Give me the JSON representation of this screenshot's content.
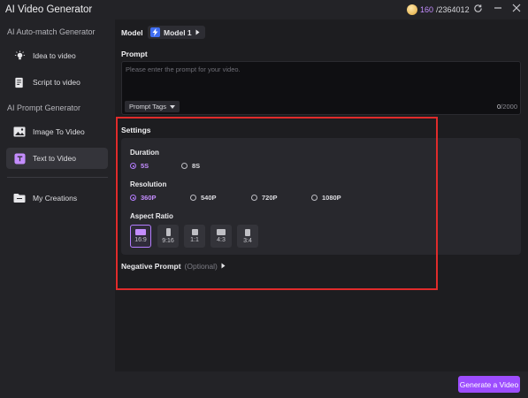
{
  "app": {
    "title": "AI Video Generator"
  },
  "credits": {
    "used": "160",
    "total": "/2364012"
  },
  "sidebar": {
    "groups": [
      "AI Auto-match Generator",
      "AI Prompt Generator"
    ],
    "items": [
      {
        "label": "Idea to video",
        "icon": "lightbulb-icon"
      },
      {
        "label": "Script to video",
        "icon": "script-icon"
      },
      {
        "label": "Image To Video",
        "icon": "image-icon"
      },
      {
        "label": "Text to Video",
        "icon": "text-icon",
        "active": true
      },
      {
        "label": "My Creations",
        "icon": "folder-icon"
      }
    ]
  },
  "model": {
    "label": "Model",
    "value": "Model 1"
  },
  "prompt": {
    "label": "Prompt",
    "placeholder": "Please enter the prompt for your video.",
    "tags_label": "Prompt Tags",
    "count_current": "0",
    "count_max": "/2000"
  },
  "settings": {
    "label": "Settings",
    "duration": {
      "label": "Duration",
      "options": [
        "5S",
        "8S"
      ],
      "selected": "5S"
    },
    "resolution": {
      "label": "Resolution",
      "options": [
        "360P",
        "540P",
        "720P",
        "1080P"
      ],
      "selected": "360P"
    },
    "aspect_ratio": {
      "label": "Aspect Ratio",
      "options": [
        "16:9",
        "9:16",
        "1:1",
        "4:3",
        "3:4"
      ],
      "selected": "16:9"
    }
  },
  "negative_prompt": {
    "label": "Negative Prompt",
    "optional": "(Optional)"
  },
  "actions": {
    "generate": "Generate a Video"
  },
  "colors": {
    "accent": "#9d4dff",
    "highlight": "#e02b2b"
  }
}
